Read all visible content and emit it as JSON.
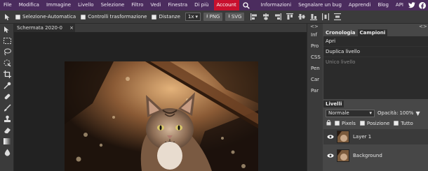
{
  "menu": {
    "items": [
      "File",
      "Modifica",
      "Immagine",
      "Livello",
      "Selezione",
      "Filtro",
      "Vedi",
      "Finestra",
      "Di più"
    ],
    "account": "Account",
    "right_items": [
      "Informazioni",
      "Segnalare un bug",
      "Apprendi",
      "Blog",
      "API"
    ]
  },
  "options": {
    "auto_select": "Selezione-Automatica",
    "transform_controls": "Controlli trasformazione",
    "distances": "Distanze",
    "scale_value": "1x",
    "png_label": "PNG",
    "svg_label": "SVG"
  },
  "document": {
    "tab_title": "Schermata 2020-0",
    "close": "×"
  },
  "mini_panels": [
    "Inf",
    "Pro",
    "CSS",
    "Pen",
    "Car",
    "Par"
  ],
  "panels": {
    "collapse_left": "<>",
    "collapse_right": "<>",
    "history_tab": "Cronologia",
    "swatches_tab": "Campioni",
    "history": [
      "Apri",
      "Duplica livello",
      "Unico livello"
    ],
    "layers_tab": "Livelli",
    "blend_mode": "Normale",
    "opacity_label": "Opacità:",
    "opacity_value": "100%",
    "lock_pixels": "Pixels",
    "lock_position": "Posizione",
    "lock_all": "Tutto",
    "layers": [
      "Layer 1",
      "Background"
    ]
  },
  "colors": {
    "menubar": "#4b2c5e",
    "account": "#c8102e",
    "panel": "#474747",
    "dark": "#2b2b2b"
  }
}
